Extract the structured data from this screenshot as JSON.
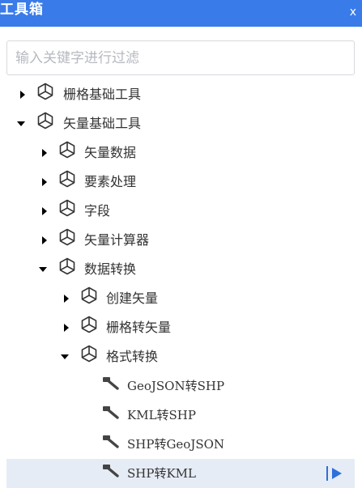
{
  "window": {
    "title": "工具箱",
    "close_label": "x"
  },
  "search": {
    "placeholder": "输入关键字进行过滤",
    "value": ""
  },
  "tree": [
    {
      "label": "栅格基础工具",
      "expanded": false,
      "type": "group",
      "level": 0
    },
    {
      "label": "矢量基础工具",
      "expanded": true,
      "type": "group",
      "level": 0
    },
    {
      "label": "矢量数据",
      "expanded": false,
      "type": "group",
      "level": 1
    },
    {
      "label": "要素处理",
      "expanded": false,
      "type": "group",
      "level": 1
    },
    {
      "label": "字段",
      "expanded": false,
      "type": "group",
      "level": 1
    },
    {
      "label": "矢量计算器",
      "expanded": false,
      "type": "group",
      "level": 1
    },
    {
      "label": "数据转换",
      "expanded": true,
      "type": "group",
      "level": 1
    },
    {
      "label": "创建矢量",
      "expanded": false,
      "type": "group",
      "level": 2
    },
    {
      "label": "栅格转矢量",
      "expanded": false,
      "type": "group",
      "level": 2
    },
    {
      "label": "格式转换",
      "expanded": true,
      "type": "group",
      "level": 2
    },
    {
      "label": "GeoJSON转SHP",
      "type": "tool",
      "level": 3
    },
    {
      "label": "KML转SHP",
      "type": "tool",
      "level": 3
    },
    {
      "label": "SHP转GeoJSON",
      "type": "tool",
      "level": 3
    },
    {
      "label": "SHP转KML",
      "type": "tool",
      "level": 3,
      "selected": true
    }
  ],
  "colors": {
    "titlebar": "#3a7bea",
    "selected_row": "#e6ecf5",
    "run_icon": "#2f6fdb",
    "text": "#333333"
  },
  "icons": {
    "group": "toolbox-cube-icon",
    "tool": "hammer-icon",
    "collapsed": "caret-right-icon",
    "expanded": "caret-down-icon",
    "run": "run-icon"
  }
}
